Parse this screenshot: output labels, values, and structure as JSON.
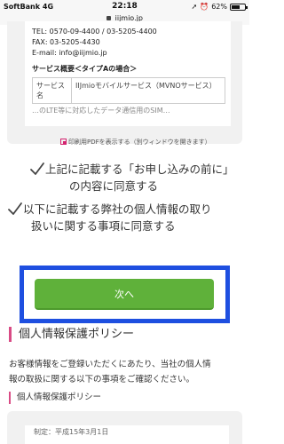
{
  "status_bar": {
    "carrier": "SoftBank",
    "network": "4G",
    "time": "22:18",
    "battery_percent": "62%",
    "icons": [
      "lock-icon",
      "location-icon",
      "alarm-icon",
      "battery-icon"
    ]
  },
  "url_bar": {
    "domain": "iijmio.jp"
  },
  "contact": {
    "tel": "TEL: 0570-09-4400 / 03-5205-4400",
    "fax": "FAX: 03-5205-4430",
    "email": "E-mail: info@iijmio.jp"
  },
  "service_overview": {
    "title": "サービス概要＜タイプAの場合＞",
    "rows": [
      {
        "label": "サービス名",
        "value": "IIJmioモバイルサービス（MVNOサービス）"
      }
    ],
    "cut_text": "…のLTE等に対応したデータ通信用のSIM…"
  },
  "print_link": {
    "label": "印刷用PDFを表示する（別ウィンドウを開きます）"
  },
  "agreements": [
    {
      "line1": "上記に記載する「お申し込みの前に」",
      "line2": "の内容に同意する"
    },
    {
      "line1": "以下に記載する弊社の個人情報の取り",
      "line2": "扱いに関する事項に同意する"
    }
  ],
  "next_button": {
    "label": "次へ"
  },
  "policy": {
    "heading": "個人情報保護ポリシー",
    "intro_line1": "お客様情報をご登録いただくにあたり、当社の個人情",
    "intro_line2": "報の取扱に関する以下の事項をご確認ください。",
    "sub_heading": "個人情報保護ポリシー",
    "partial_text": "制定：平成15年3月1日"
  },
  "colors": {
    "accent_pink": "#d94b85",
    "button_green": "#5fb13a",
    "highlight_blue": "#1e4fe0",
    "card_gray": "#f1f1f1"
  }
}
